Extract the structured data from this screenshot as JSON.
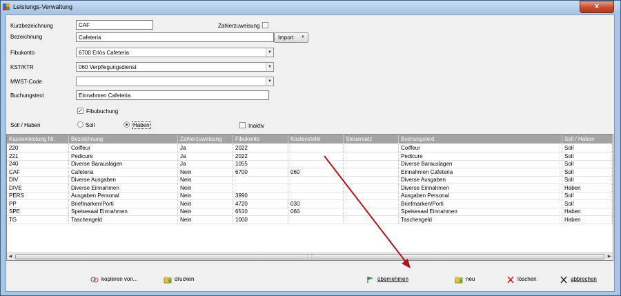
{
  "window": {
    "title": "Leistungs-Verwaltung",
    "close_label": "x"
  },
  "form": {
    "kurzbezeichnung": {
      "label": "Kurzbezeichnung",
      "value": "CAF"
    },
    "zahlerzuweisung": {
      "label": "Zahlerzuweisung",
      "checked": false
    },
    "bezeichnung": {
      "label": "Bezeichnung",
      "value": "Cafeteria"
    },
    "import_button": "Import",
    "fibukonto": {
      "label": "Fibukonto",
      "value": "6700 Erlös Cafeteria"
    },
    "kst_ktr": {
      "label": "KST/KTR",
      "value": "060 Verpflegungsdienst"
    },
    "mwst_code": {
      "label": "MWST-Code",
      "value": ""
    },
    "buchungstext": {
      "label": "Buchungstext",
      "value": "Einnahmen Cafeteria"
    },
    "fibubuchung": {
      "label": "Fibubuchung",
      "checked": true
    },
    "soll_haben": {
      "label": "Soll / Haben",
      "soll": "Soll",
      "haben": "Haben",
      "selected": "Haben"
    },
    "inaktiv": {
      "label": "Inaktiv",
      "checked": false
    }
  },
  "table": {
    "columns": [
      "Kassenleistung Nr.",
      "Bezeichnung",
      "Zahlerzuweisung",
      "Fibukonto",
      "Kostenstelle",
      "Steuersatz",
      "Buchungstext",
      "Soll / Haben"
    ],
    "rows": [
      [
        "220",
        "Coiffeur",
        "Ja",
        "2022",
        "",
        "",
        "Coiffeur",
        "Soll"
      ],
      [
        "221",
        "Pedicure",
        "Ja",
        "2022",
        "",
        "",
        "Pedicure",
        "Soll"
      ],
      [
        "240",
        "Diverse Barauslagen",
        "Ja",
        "1055",
        "",
        "",
        "Diverse Barauslagen",
        "Soll"
      ],
      [
        "CAF",
        "Cafeteria",
        "Nein",
        "6700",
        "060",
        "",
        "Einnahmen Cafeteria",
        "Soll"
      ],
      [
        "DIV",
        "Diverse Ausgaben",
        "Nein",
        "",
        "",
        "",
        "Diverse Ausgaben",
        "Soll"
      ],
      [
        "DIVE",
        "Diverse Einnahmen",
        "Nein",
        "",
        "",
        "",
        "Diverse Einnahmen",
        "Haben"
      ],
      [
        "PERS",
        "Ausgaben Personal",
        "Nein",
        "3990",
        "",
        "",
        "Ausgaben Personal",
        "Soll"
      ],
      [
        "PP",
        "Briefmarken/Porti",
        "Nein",
        "4720",
        "030",
        "",
        "Briefmarken/Porti",
        "Soll"
      ],
      [
        "SPE",
        "Speisesaal Einnahmen",
        "Nein",
        "6510",
        "060",
        "",
        "Speisesaal Einnahmen",
        "Haben"
      ],
      [
        "TG",
        "Taschengeld",
        "Nein",
        "1000",
        "",
        "",
        "Taschengeld",
        "Haben"
      ]
    ]
  },
  "footer": {
    "kopieren": "kopieren von...",
    "drucken": "drucken",
    "uebernehmen": "übernehmen",
    "neu": "neu",
    "loeschen": "löschen",
    "abbrechen": "abbrechen"
  },
  "colors": {
    "arrow": "#b0141a",
    "header_bg": "#a3a3a3",
    "window_frame": "#a9c6e6"
  }
}
